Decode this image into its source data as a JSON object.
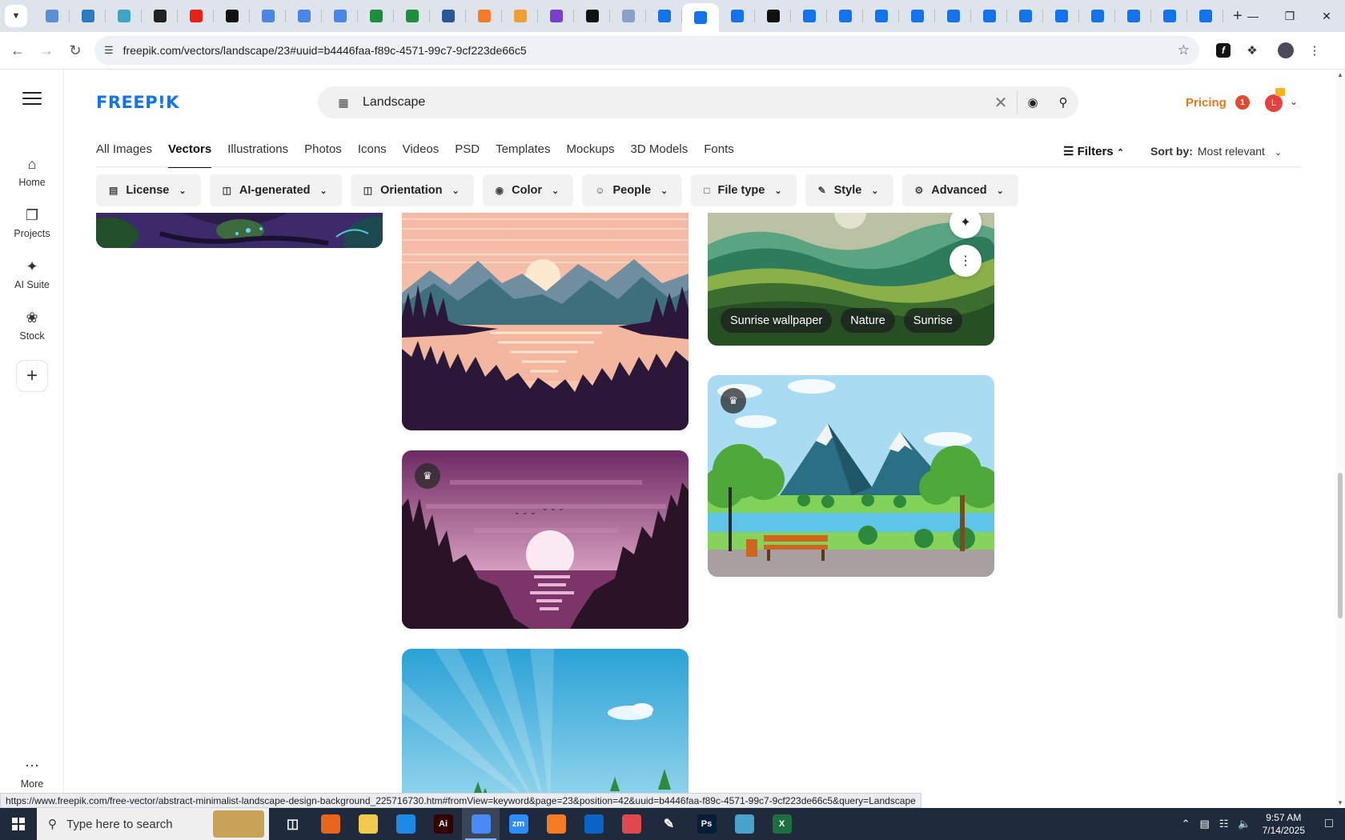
{
  "browser": {
    "tabs": [
      {
        "icon": "globe-icon",
        "color": "#5b8fd8"
      },
      {
        "icon": "shield-icon",
        "color": "#2b7bbf"
      },
      {
        "icon": "diamond-icon",
        "color": "#3aa6c4"
      },
      {
        "icon": "openai-icon",
        "color": "#222222"
      },
      {
        "icon": "youtube-icon",
        "color": "#e62117"
      },
      {
        "icon": "bolt-icon",
        "color": "#111111"
      },
      {
        "icon": "docs-icon",
        "color": "#4a86e8"
      },
      {
        "icon": "docs-icon",
        "color": "#4a86e8"
      },
      {
        "icon": "docs-icon",
        "color": "#4a86e8"
      },
      {
        "icon": "sheets-icon",
        "color": "#1e8e3e"
      },
      {
        "icon": "sheets-icon",
        "color": "#1e8e3e"
      },
      {
        "icon": "word-icon",
        "color": "#2b579a"
      },
      {
        "icon": "xampp-icon",
        "color": "#f57c24"
      },
      {
        "icon": "arrow-icon",
        "color": "#f0a030"
      },
      {
        "icon": "braces-icon",
        "color": "#7a3fd1"
      },
      {
        "icon": "ai-icon",
        "color": "#111111"
      },
      {
        "icon": "apps-icon",
        "color": "#8aa0c8"
      },
      {
        "icon": "freepik-icon",
        "color": "#1273eb"
      },
      {
        "icon": "freepik-icon",
        "color": "#1273eb",
        "active": true
      },
      {
        "icon": "freepik-icon",
        "color": "#1273eb"
      },
      {
        "icon": "m-icon",
        "color": "#111111"
      },
      {
        "icon": "freepik-icon",
        "color": "#1273eb"
      },
      {
        "icon": "freepik-icon",
        "color": "#1273eb"
      },
      {
        "icon": "freepik-icon",
        "color": "#1273eb"
      },
      {
        "icon": "freepik-icon",
        "color": "#1273eb"
      },
      {
        "icon": "freepik-icon",
        "color": "#1273eb"
      },
      {
        "icon": "freepik-icon",
        "color": "#1273eb"
      },
      {
        "icon": "freepik-icon",
        "color": "#1273eb"
      },
      {
        "icon": "freepik-icon",
        "color": "#1273eb"
      },
      {
        "icon": "freepik-icon",
        "color": "#1273eb"
      },
      {
        "icon": "freepik-icon",
        "color": "#1273eb"
      },
      {
        "icon": "freepik-icon",
        "color": "#1273eb"
      },
      {
        "icon": "freepik-icon",
        "color": "#1273eb"
      }
    ],
    "url": "freepik.com/vectors/landscape/23#uuid=b4446faa-f89c-4571-99c7-9cf223de66c5"
  },
  "sidebar": {
    "items": [
      {
        "label": "Home",
        "icon": "home-icon"
      },
      {
        "label": "Projects",
        "icon": "projects-icon"
      },
      {
        "label": "AI Suite",
        "icon": "sparkle-icon"
      },
      {
        "label": "Stock",
        "icon": "stock-icon"
      }
    ],
    "more_label": "More"
  },
  "header": {
    "logo": "FREEP!K",
    "search_query": "Landscape",
    "pricing": "Pricing",
    "notification_count": "1",
    "accent": "#1273eb",
    "pricing_color": "#e5781b"
  },
  "category_tabs": [
    "All Images",
    "Vectors",
    "Illustrations",
    "Photos",
    "Icons",
    "Videos",
    "PSD",
    "Templates",
    "Mockups",
    "3D Models",
    "Fonts"
  ],
  "active_tab": "Vectors",
  "filters_label": "Filters",
  "sort": {
    "label": "Sort by:",
    "value": "Most relevant"
  },
  "filter_chips": [
    {
      "label": "License",
      "icon": "license-icon"
    },
    {
      "label": "AI-generated",
      "icon": "ai-generated-icon"
    },
    {
      "label": "Orientation",
      "icon": "orientation-icon"
    },
    {
      "label": "Color",
      "icon": "palette-icon"
    },
    {
      "label": "People",
      "icon": "people-icon"
    },
    {
      "label": "File type",
      "icon": "file-icon"
    },
    {
      "label": "Style",
      "icon": "brush-icon"
    },
    {
      "label": "Advanced",
      "icon": "settings-icon"
    }
  ],
  "results": {
    "hover_tags": [
      "Sunrise wallpaper",
      "Nature",
      "Sunrise"
    ]
  },
  "status_url": "https://www.freepik.com/free-vector/abstract-minimalist-landscape-design-background_225716730.htm#fromView=keyword&page=23&position=42&uuid=b4446faa-f89c-4571-99c7-9cf223de66c5&query=Landscape",
  "taskbar": {
    "search_placeholder": "Type here to search",
    "time": "9:57 AM",
    "date": "7/14/2025",
    "apps": [
      {
        "icon": "task-view-icon",
        "color": "#1f2a3c",
        "text": ""
      },
      {
        "icon": "firefox-icon",
        "color": "#e8651d",
        "text": ""
      },
      {
        "icon": "file-explorer-icon",
        "color": "#f2c94c",
        "text": ""
      },
      {
        "icon": "vscode-icon",
        "color": "#1e88e5",
        "text": ""
      },
      {
        "icon": "illustrator-icon",
        "color": "#330000",
        "text": "Ai"
      },
      {
        "icon": "chrome-icon",
        "color": "#4a8af4",
        "text": "",
        "active": true
      },
      {
        "icon": "zoom-icon",
        "color": "#2d8cff",
        "text": "zm"
      },
      {
        "icon": "xampp-icon",
        "color": "#f57c24",
        "text": ""
      },
      {
        "icon": "outlook-icon",
        "color": "#0a64c8",
        "text": ""
      },
      {
        "icon": "creative-cloud-icon",
        "color": "#e34850",
        "text": ""
      },
      {
        "icon": "pen-icon",
        "color": "#1f2a3c",
        "text": ""
      },
      {
        "icon": "photoshop-icon",
        "color": "#001e36",
        "text": "Ps"
      },
      {
        "icon": "gem-icon",
        "color": "#4aa3c8",
        "text": ""
      },
      {
        "icon": "excel-icon",
        "color": "#1d6f42",
        "text": "X"
      }
    ]
  }
}
